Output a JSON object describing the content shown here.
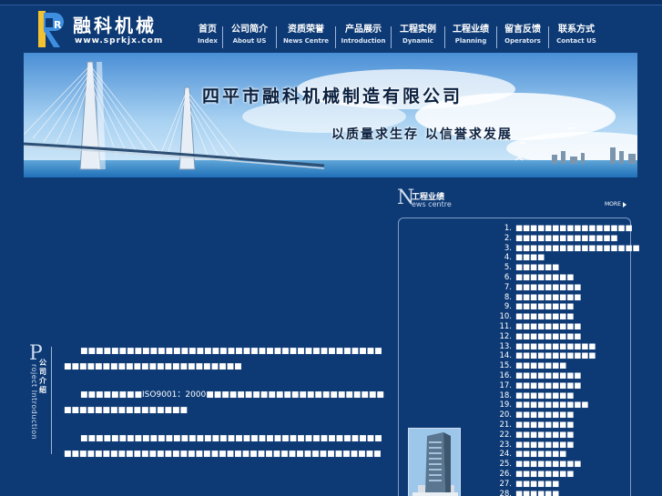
{
  "site": {
    "logo_title": "融科机械",
    "logo_url": "www.sprkjx.com",
    "logo_letter": "R"
  },
  "nav": [
    {
      "zh": "首页",
      "en": "Index"
    },
    {
      "zh": "公司简介",
      "en": "About US"
    },
    {
      "zh": "资质荣誉",
      "en": "News Centre"
    },
    {
      "zh": "产品展示",
      "en": "Introduction"
    },
    {
      "zh": "工程实例",
      "en": "Dynamic"
    },
    {
      "zh": "工程业绩",
      "en": "Planning"
    },
    {
      "zh": "留言反馈",
      "en": "Operators"
    },
    {
      "zh": "联系方式",
      "en": "Contact US"
    }
  ],
  "banner": {
    "title": "四平市融科机械制造有限公司",
    "slogan": "以质量求生存  以信誉求发展"
  },
  "intro": {
    "big_letter": "P",
    "title": "公司介绍",
    "subtitle": "roject Introduction",
    "paragraphs": [
      "■■■■■■■■■■■■■■■■■■■■■■■■■■■■■■■■■■■■■■■■■■■■■■■■■■■■■■■■■■■■■■",
      "■■■■■■■■ISO9001：2000■■■■■■■■■■■■■■■■■■■■■■■■■■■■■■■■■■■■■■■",
      "■■■■■■■■■■■■■■■■■■■■■■■■■■■■■■■■■■■■■■■■■■■■■■■■■■■■■■■■■■■■■■■■■■■■■■■■■■■■■■■■"
    ]
  },
  "news": {
    "big_letter": "N",
    "title": "工程业绩",
    "subtitle": "ews centre",
    "more": "MORE",
    "items": [
      {
        "num": "1.",
        "text": "■■■■■■■■■■■■■■■■"
      },
      {
        "num": "2.",
        "text": "■■■■■■■■■■■■■■"
      },
      {
        "num": "3.",
        "text": "■■■■■■■■■■■■■■■■■"
      },
      {
        "num": "4.",
        "text": "■■■■"
      },
      {
        "num": "5.",
        "text": "■■■■■■"
      },
      {
        "num": "6.",
        "text": "■■■■■■■■"
      },
      {
        "num": "7.",
        "text": "■■■■■■■■■"
      },
      {
        "num": "8.",
        "text": "■■■■■■■■■"
      },
      {
        "num": "9.",
        "text": "■■■■■■■■"
      },
      {
        "num": "10.",
        "text": "■■■■■■■■"
      },
      {
        "num": "11.",
        "text": "■■■■■■■■■"
      },
      {
        "num": "12.",
        "text": "■■■■■■■■■"
      },
      {
        "num": "13.",
        "text": "■■■■■■■■■■■"
      },
      {
        "num": "14.",
        "text": "■■■■■■■■■■■"
      },
      {
        "num": "15.",
        "text": "■■■■■■■"
      },
      {
        "num": "16.",
        "text": "■■■■■■■■■"
      },
      {
        "num": "17.",
        "text": "■■■■■■■■■"
      },
      {
        "num": "18.",
        "text": "■■■■■■■■"
      },
      {
        "num": "19.",
        "text": "■■■■■■■■■■"
      },
      {
        "num": "20.",
        "text": "■■■■■■■■"
      },
      {
        "num": "21.",
        "text": "■■■■■■■■"
      },
      {
        "num": "22.",
        "text": "■■■■■■■■"
      },
      {
        "num": "23.",
        "text": "■■■■■■■■"
      },
      {
        "num": "24.",
        "text": "■■■■■■■"
      },
      {
        "num": "25.",
        "text": "■■■■■■■■■"
      },
      {
        "num": "26.",
        "text": "■■■■■■■■"
      },
      {
        "num": "27.",
        "text": "■■■■■■"
      },
      {
        "num": "28.",
        "text": "■■■■■■"
      }
    ]
  },
  "colors": {
    "page_bg": "#0d3a75",
    "accent": "#7f9dc7"
  }
}
